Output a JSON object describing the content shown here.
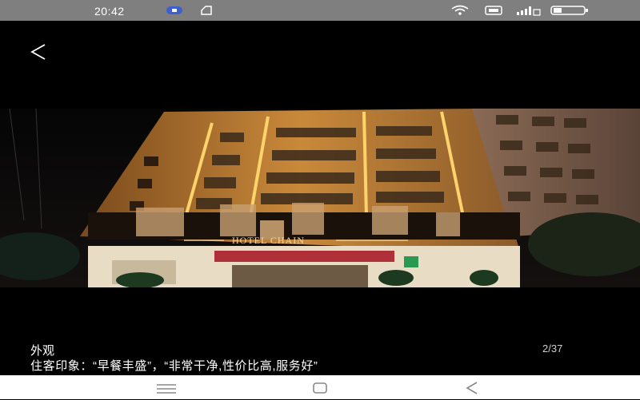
{
  "status_bar": {
    "time": "20:42",
    "icons": [
      "app-notification-icon",
      "sim-icon",
      "wifi-icon",
      "nfc-icon",
      "signal-icon",
      "battery-icon"
    ]
  },
  "header": {
    "back_icon": "chevron-left-icon"
  },
  "photo": {
    "alt": "外观",
    "sign_text": "HOTEL CHAIN"
  },
  "caption": {
    "title": "外观",
    "page_counter": "2/37",
    "body": "住客印象：“早餐丰盛”，“非常干净,性价比高,服务好”"
  },
  "nav_bar": {
    "icons": [
      "menu-icon",
      "home-icon",
      "back-icon"
    ]
  },
  "colors": {
    "status_bar": "#7f7f7f",
    "background": "#000000",
    "nav_bar": "#ffffff",
    "facade_light": "#f2b84b"
  }
}
